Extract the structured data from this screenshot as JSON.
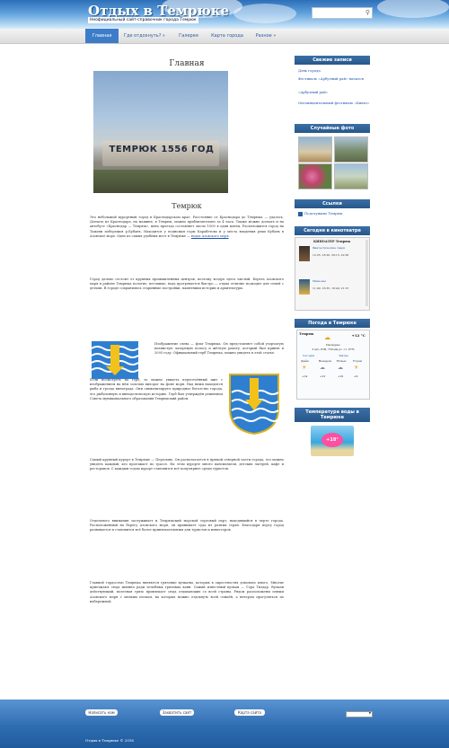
{
  "header": {
    "site_title": "Отдых в Темрюке",
    "tagline": "Неофициальный сайт-справочник города Темрюк"
  },
  "nav": {
    "items": [
      {
        "label": "Главная",
        "active": true
      },
      {
        "label": "Где отдохнуть? »",
        "active": false
      },
      {
        "label": "Галерея",
        "active": false
      },
      {
        "label": "Карта города",
        "active": false
      },
      {
        "label": "Разное »",
        "active": false
      }
    ]
  },
  "main": {
    "page_title": "Главная",
    "hero_text": "ТЕМРЮК 1556 ГОД",
    "sub_title": "Темрюк",
    "paragraphs": [
      "Это небольшой курортный город в Краснодарском крае. Расстояние от Краснодара до Темрюка — удалось. Доехать из Краснодара, на машине, в Темрюк, можно приблизительно за 4 часа. Также можно доехать и на автобусе «Краснодар — Темрюк», цена проезда составляет около 1000 в один конец. Расположится город на Тамани побережья р.Кубань. Находится у подножья горы Карабетова и у места впадения реки Кубань в Азовское море. Одно из самых удобных мест в Темрюке — ",
      "Город далеко отстоит от крупных промышленных центров, поэтому воздух здесь чистый. Берега Азовского моря в районе Темрюка пологие, песчаные, вода прогревается быстро — отдых отлично подходит для семей с детьми. В городе сохранились старинные постройки, памятники истории и архитектуры.",
      "Изображение слева — флаг Темрюка. Он представляет собой узорчатую волнистую лазоревую полосу и жёлтую ракету, который был принят в 2005 году. Официальный герб Темрюка, можно увидеть в этой статье.",
      "Если посмотреть на герб, то можно увидеть пересечённый щит с изображением на нём золотых вилорог на фоне моря. Над ними находится рыба и гроздь винограда. Они символизируют природное богатство города, его рыболовную и винодельческую историю. Герб был утверждён решением Совета муниципального образования Темрюкский район.",
      "Самый крупный курорт в Темрюке — Пересыпь. Он располагается в прямой северной части города, его можно увидеть каждый, кто проезжает по трассе. На этом курорте много пансионатов, детских лагерей, кафе и ресторанов. С каждым годом курорт становится всё популярнее среди туристов.",
      "Отдельного внимания заслуживает и Темрюкский морской торговый порт, находящийся в черте города. Расположенный на берегу Азовского моря, он принимает суда из разных стран. Благодаря порту город развивается и становится всё более привлекательным для туристов и инвесторов.",
      "Главной гордостью Темрюка являются грязевые вулканы, которых в окрестностях довольно много. Многие приезжают сюда именно ради лечебных грязевых ванн. Самый известный вулкан — Гора Тиздар. Вулкан действующий, полезная грязь привлекает сюда отдыхающих со всей страны. Рядом расположены пляжи Азовского моря с мелким песком, на которых можно отдохнуть всей семьёй, а вечером прогуляться по набережной."
    ],
    "para_link": "водах Азовского моря"
  },
  "sidebar": {
    "new_posts_title": "Свежие записи",
    "new_posts": [
      "День города",
      "Фестиваль «Арбузный рай» начался",
      "«Арбузный рай»",
      "Оптоинцентальный фестиваль «Кинат»"
    ],
    "photos_title": "Случайные фото",
    "links_title": "Ссылки",
    "links": [
      "Подслушано Темрюк"
    ],
    "cinema_title": "Сегодня в кинотеатре",
    "cinema_name": "КИНОАТЕР Темрюк",
    "cinema_films": [
      {
        "name": "Фантастические твари",
        "times": "12:25, 18:20, 20:15, 22:30"
      },
      {
        "name": "Миньоны",
        "times": "11:40, 16:35, 18:40, 21:15"
      }
    ],
    "weather_title": "Погода в Темрюке",
    "weather_city": "Темрюк",
    "weather_temp": "+12 °С",
    "weather_desc": "Пасмурно",
    "weather_info": "3 м/с, ЮВ, 759 мм рт. ст. 87%",
    "weather_today": "Сегодня",
    "weather_tomorrow": "Завтра",
    "weather_cols": [
      "Днём",
      "Вечером",
      "Ночью",
      "Утром"
    ],
    "weather_vals": [
      "+14",
      "+12",
      "+10",
      "+9"
    ],
    "water_title": "Температура воды в Темрюке",
    "water_temp": "+18°"
  },
  "footer": {
    "buttons": [
      "Написать нам",
      "Захватить сайт",
      "Карта сайта"
    ],
    "copyright": "Отдых в Темрюке © 2016"
  }
}
